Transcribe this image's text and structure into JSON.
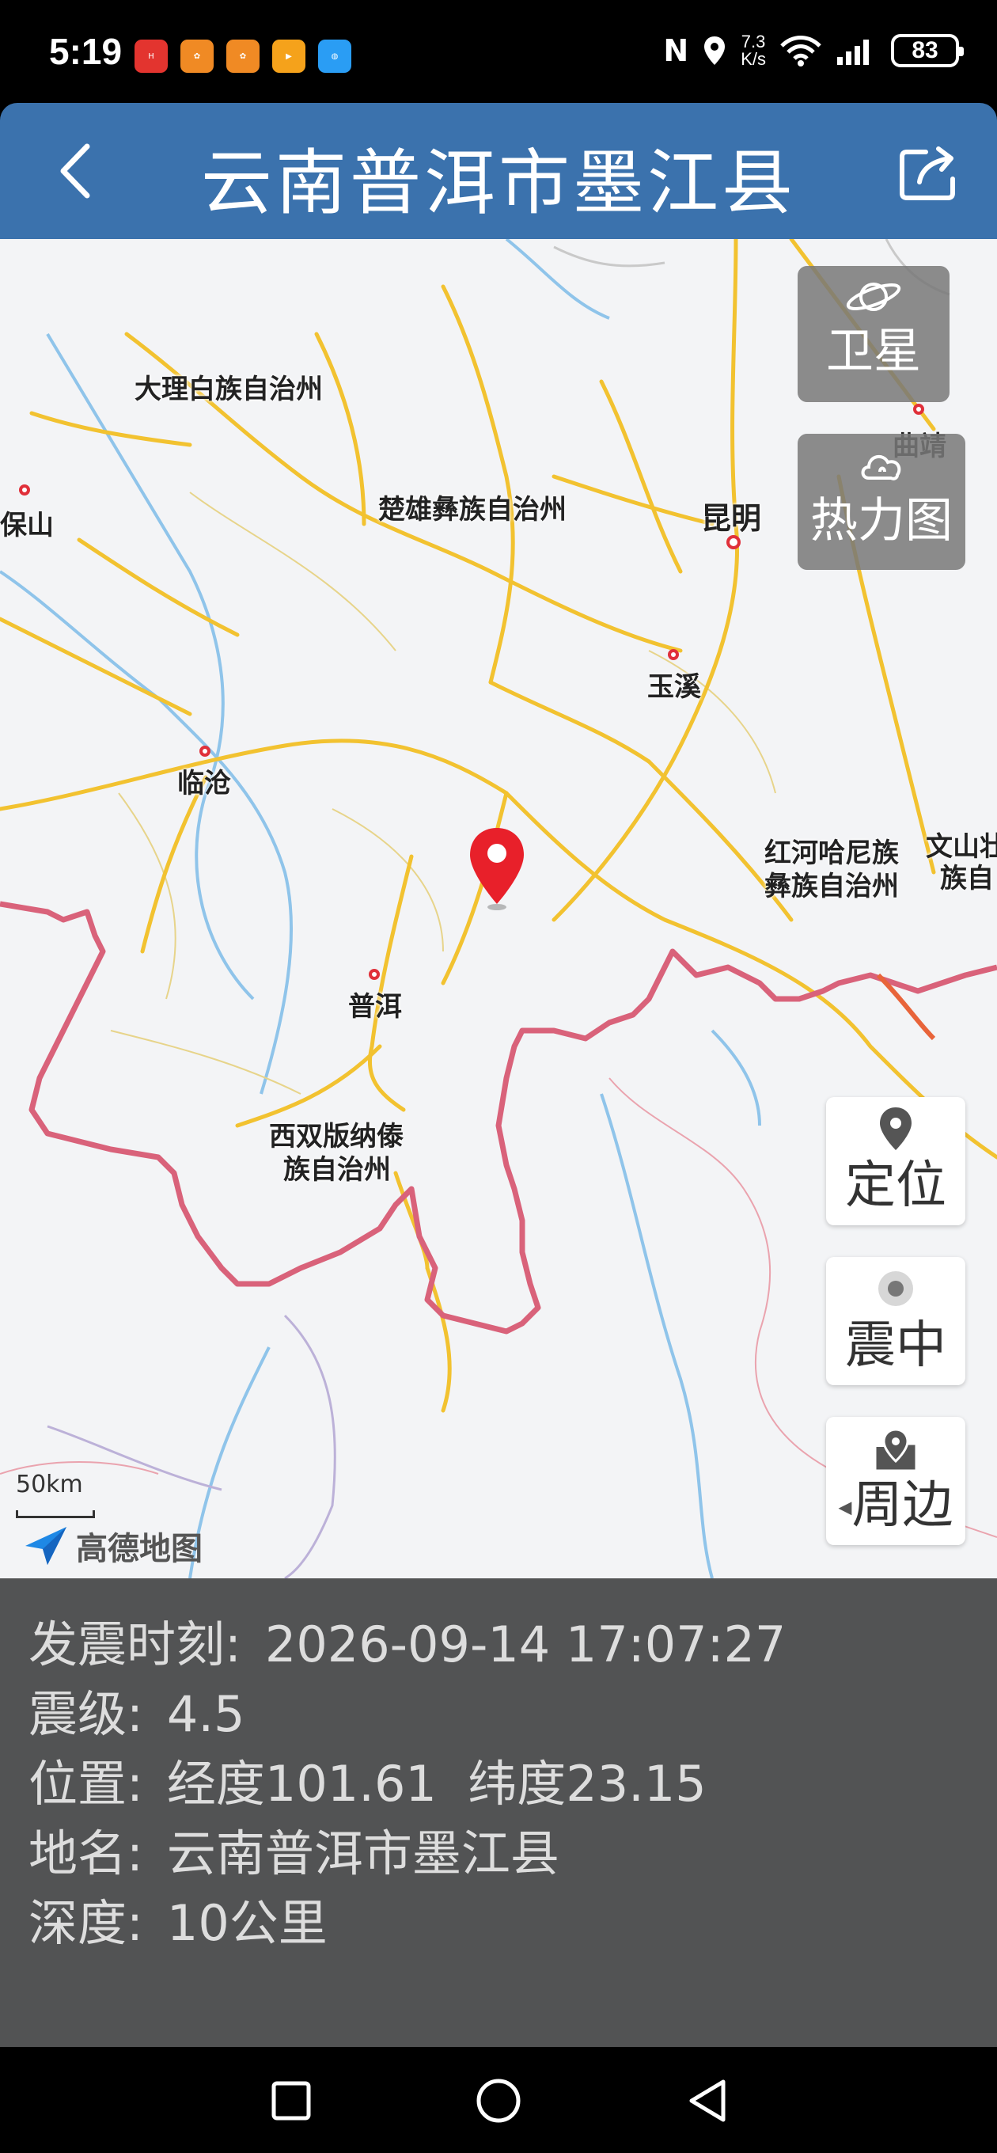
{
  "status_bar": {
    "time": "5:19",
    "notif_icons": [
      "huawei-app-icon",
      "app-orange-icon",
      "app-orange-icon",
      "video-app-icon",
      "globe-app-icon"
    ],
    "net_speed_value": "7.3",
    "net_speed_unit": "K/s",
    "battery": "83"
  },
  "header": {
    "title": "云南普洱市墨江县"
  },
  "map": {
    "labels": {
      "dali": "大理白族自治州",
      "chuxiong": "楚雄彝族自治州",
      "kunming": "昆明",
      "qujing": "曲靖",
      "baoshan": "保山",
      "yuxi": "玉溪",
      "lincang": "临沧",
      "honghe_1": "红河哈尼族",
      "honghe_2": "彝族自治州",
      "wenshan_1": "文山壮",
      "wenshan_2": "族自",
      "puer": "普洱",
      "xsbn_1": "西双版纳傣",
      "xsbn_2": "族自治州"
    },
    "satellite_label": "卫星",
    "heatmap_label": "热力图",
    "locate_label": "定位",
    "epicenter_label": "震中",
    "nearby_label": "周边",
    "scale": "50km",
    "logo": "高德地图"
  },
  "info": {
    "time_label": "发震时刻:",
    "time_value": "2026-09-14 17:07:27",
    "magnitude_label": "震级:",
    "magnitude_value": "4.5",
    "position_label": "位置:",
    "position_value": "经度101.61  纬度23.15",
    "place_label": "地名:",
    "place_value": "云南普洱市墨江县",
    "depth_label": "深度:",
    "depth_value": "10公里"
  },
  "colors": {
    "header": "#3b72ad",
    "info_panel": "#525354",
    "marker": "#e8202a",
    "border": "#d9627a",
    "road": "#f2c230"
  }
}
